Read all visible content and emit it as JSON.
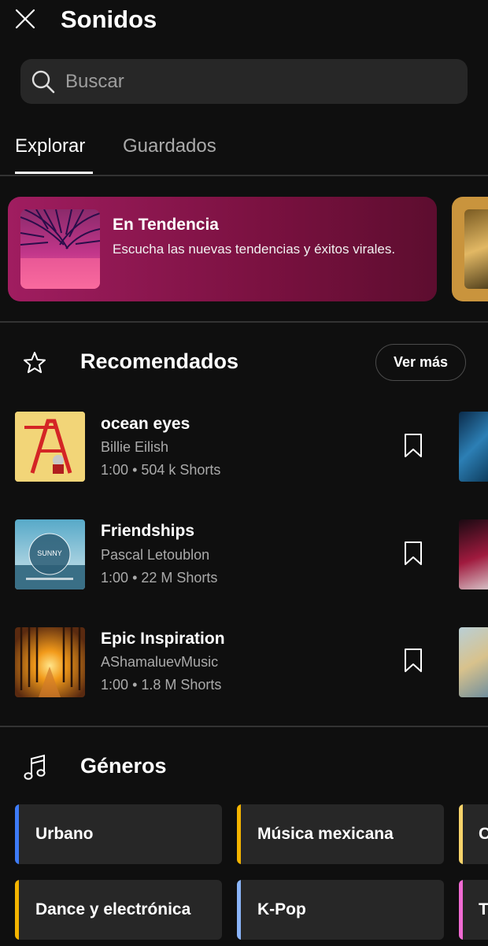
{
  "header": {
    "title": "Sonidos",
    "close_icon": "close-icon"
  },
  "search": {
    "placeholder": "Buscar"
  },
  "tabs": [
    {
      "label": "Explorar",
      "active": true
    },
    {
      "label": "Guardados",
      "active": false
    }
  ],
  "banner": {
    "title": "En Tendencia",
    "description": "Escucha las nuevas tendencias y éxitos virales."
  },
  "recommended": {
    "title": "Recomendados",
    "icon": "star-icon",
    "more_label": "Ver más",
    "songs": [
      {
        "title": "ocean eyes",
        "artist": "Billie Eilish",
        "duration": "1:00",
        "shorts": "504 k Shorts"
      },
      {
        "title": "Friendships",
        "artist": "Pascal Letoublon",
        "duration": "1:00",
        "shorts": "22 M Shorts"
      },
      {
        "title": "Epic Inspiration",
        "artist": "AShamaluevMusic",
        "duration": "1:00",
        "shorts": "1.8 M Shorts"
      }
    ]
  },
  "genres": {
    "title": "Géneros",
    "icon": "music-note-icon",
    "items": [
      {
        "label": "Urbano",
        "color": "#3d7bf7"
      },
      {
        "label": "Música mexicana",
        "color": "#f4b400"
      },
      {
        "label": "C",
        "color": "#f6d36a"
      },
      {
        "label": "Dance y electrónica",
        "color": "#f4b400"
      },
      {
        "label": "K-Pop",
        "color": "#8ab4f8"
      },
      {
        "label": "T",
        "color": "#f06ad2"
      }
    ]
  },
  "colors": {
    "background": "#0f0f0f",
    "surface": "#272727",
    "banner": "#a01d60"
  }
}
